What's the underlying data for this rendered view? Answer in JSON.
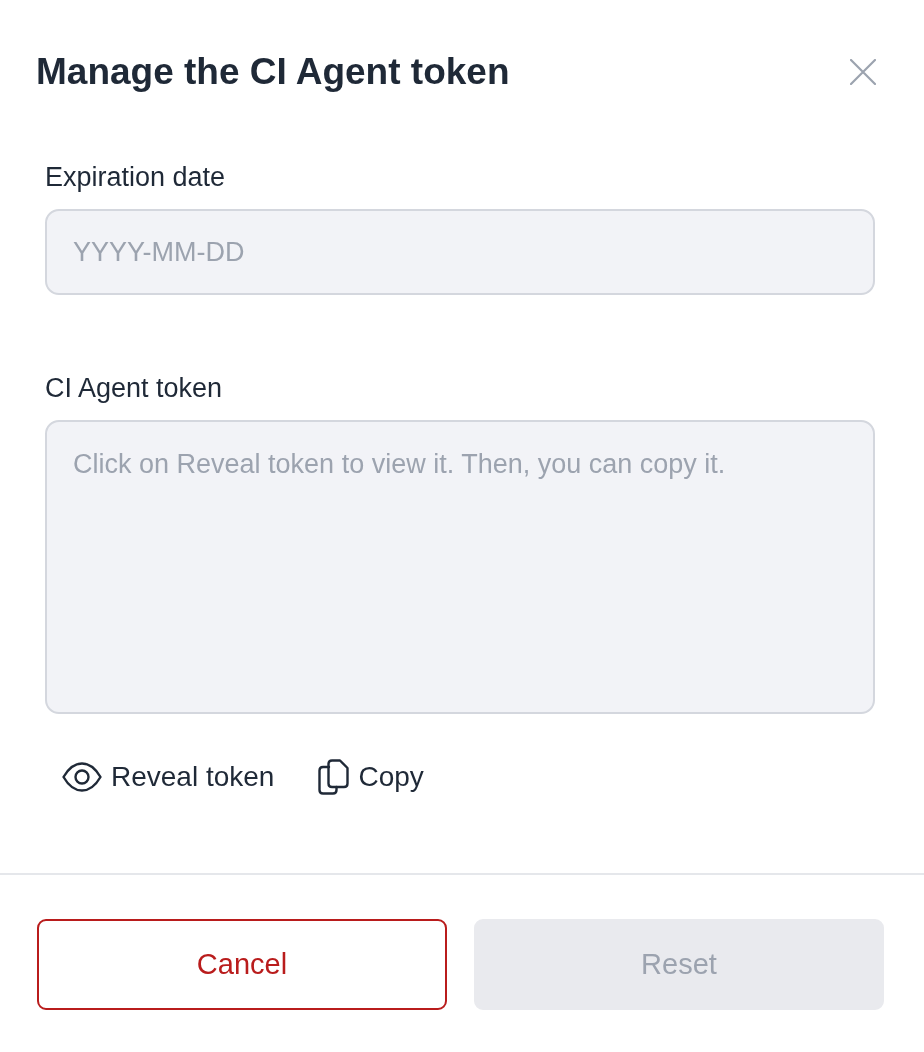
{
  "dialog": {
    "title": "Manage the CI Agent token"
  },
  "fields": [
    {
      "kind": "input",
      "label": "Expiration date",
      "placeholder": "YYYY-MM-DD"
    },
    {
      "kind": "textarea",
      "label": "CI Agent token",
      "placeholder": "Click on Reveal token to view it. Then, you can copy it."
    }
  ],
  "actions": [
    {
      "kind": "reveal",
      "label": "Reveal token"
    },
    {
      "kind": "copy",
      "label": "Copy"
    }
  ],
  "buttons": [
    {
      "kind": "secondary",
      "label": "Cancel",
      "disabled": false
    },
    {
      "kind": "primary",
      "label": "Reset",
      "disabled": true
    }
  ]
}
